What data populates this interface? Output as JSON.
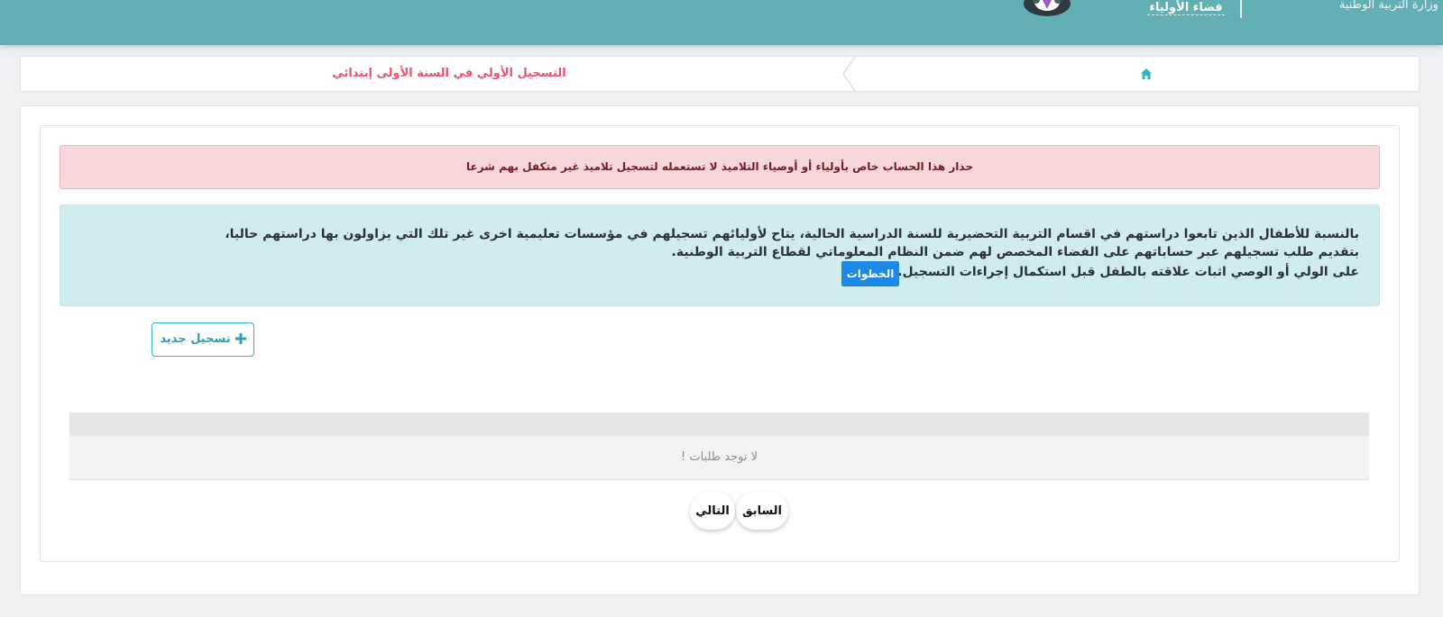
{
  "header": {
    "brand_text": "فضاء الأولياء",
    "ministry_text": "وزارة التربية الوطنية"
  },
  "breadcrumb": {
    "home_icon": "home-icon",
    "current": "التسجيل الأولي في السنة الأولى إبتدائي"
  },
  "alerts": {
    "warning": "حذار هذا الحساب خاص بأولياء أو أوصياء التلاميذ لا تستعمله لتسجيل تلاميذ غير متكفل بهم شرعا",
    "info_line1": "بالنسبة للأطفال الذين تابعوا دراستهم في اقسام التربية التحضيرية للسنة الدراسية الحالية، يتاح لأوليائهم تسجيلهم في مؤسسات تعليمية اخرى غير تلك التي يزاولون بها دراستهم حاليا،",
    "info_line2": "بتقديم طلب تسجيلهم عبر حساباتهم على الفضاء المخصص لهم ضمن النظام المعلوماتي لقطاع التربية الوطنية.",
    "info_line3": "على الولي أو الوصي اثبات علاقته بالطفل قبل استكمال إجراءات التسجيل.",
    "steps_button": "الخطوات"
  },
  "actions": {
    "new_registration": "تسجيل جديد",
    "new_icon": "plus-icon"
  },
  "table": {
    "empty_message": "لا توجد طلبات !"
  },
  "pagination": {
    "previous": "السابق",
    "next": "التالي"
  },
  "colors": {
    "header_bg": "#62b0b4",
    "breadcrumb_active": "#f0506e",
    "accent": "#2cb5c6",
    "steps_button": "#1e88e5",
    "danger_bg": "#f8d7da",
    "info_bg": "#d1ecf1"
  }
}
